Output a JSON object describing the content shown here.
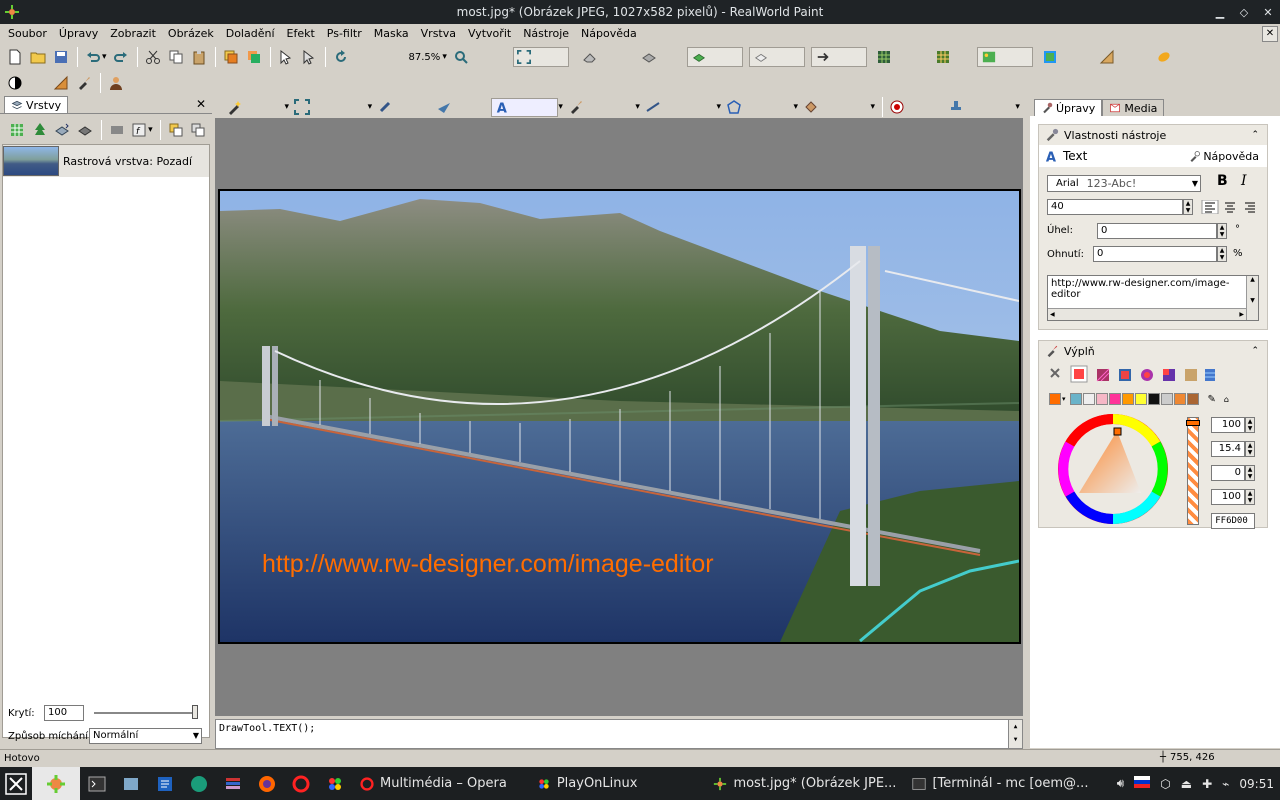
{
  "window": {
    "title": "most.jpg* (Obrázek JPEG, 1027x582 pixelů) - RealWorld Paint"
  },
  "menu": [
    "Soubor",
    "Úpravy",
    "Zobrazit",
    "Obrázek",
    "Doladění",
    "Efekt",
    "Ps-filtr",
    "Maska",
    "Vrstva",
    "Vytvořit",
    "Nástroje",
    "Nápověda"
  ],
  "toolbar": {
    "zoom": "87.5%"
  },
  "layers": {
    "tab": "Vrstvy",
    "item": "Rastrová vrstva: Pozadí",
    "opacity_label": "Krytí:",
    "opacity_value": "100",
    "blend_label": "Způsob míchání:",
    "blend_value": "Normální"
  },
  "canvas": {
    "overlay_text": "http://www.rw-designer.com/image-editor"
  },
  "command": "DrawTool.TEXT();",
  "rightpanel": {
    "tabs": [
      "Úpravy",
      "Media"
    ],
    "toolprops": {
      "header": "Vlastnosti nástroje",
      "tool": "Text",
      "help": "Nápověda",
      "font": "Arial",
      "sample": "123-Abc!",
      "size": "40",
      "angle_label": "Úhel:",
      "angle": "0",
      "angle_unit": "°",
      "bend_label": "Ohnutí:",
      "bend": "0",
      "bend_unit": "%",
      "text": "http://www.rw-designer.com/image-editor",
      "bold": "B",
      "italic": "I"
    },
    "fill": {
      "header": "Výplň",
      "values": [
        "100",
        "15.4",
        "0",
        "100"
      ],
      "hex": "FF6D00",
      "accent": "#ff6d00"
    }
  },
  "status": {
    "left": "Hotovo",
    "coords": "755, 426"
  },
  "taskbar": {
    "items": [
      "Multimédia – Opera",
      "PlayOnLinux",
      "most.jpg* (Obrázek JPE...",
      "[Terminál - mc [oem@..."
    ],
    "clock": "09:51"
  }
}
